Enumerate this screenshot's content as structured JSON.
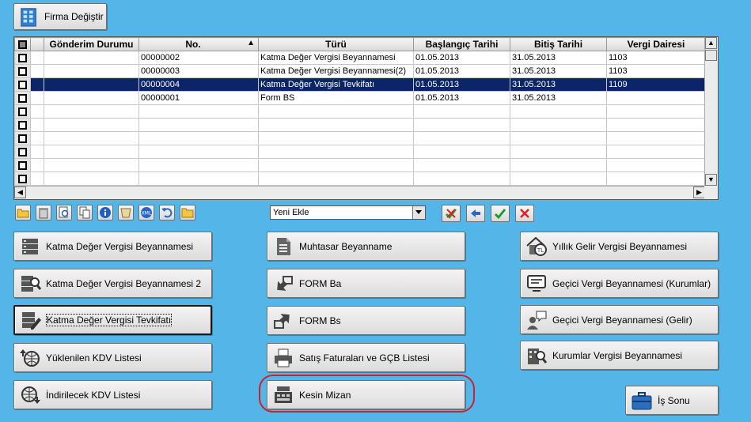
{
  "top_button": {
    "label": "Firma Değiştir",
    "icon": "building-icon"
  },
  "grid": {
    "columns": [
      "Gönderim Durumu",
      "No.",
      "Türü",
      "Başlangıç Tarihi",
      "Bitiş Tarihi",
      "Vergi Dairesi"
    ],
    "sort_indicator": "▲",
    "selected_row": 2,
    "rows": [
      {
        "status": "",
        "no": "00000002",
        "type": "Katma Değer Vergisi Beyannamesi",
        "start": "01.05.2013",
        "end": "31.05.2013",
        "office": "1103"
      },
      {
        "status": "",
        "no": "00000003",
        "type": "Katma Değer Vergisi Beyannamesi(2)",
        "start": "01.05.2013",
        "end": "31.05.2013",
        "office": "1103"
      },
      {
        "status": "",
        "no": "00000004",
        "type": "Katma Değer Vergisi Tevkifatı",
        "start": "01.05.2013",
        "end": "31.05.2013",
        "office": "1109"
      },
      {
        "status": "",
        "no": "00000001",
        "type": "Form BS",
        "start": "01.05.2013",
        "end": "31.05.2013",
        "office": ""
      },
      {
        "status": "",
        "no": "",
        "type": "",
        "start": "",
        "end": "",
        "office": ""
      },
      {
        "status": "",
        "no": "",
        "type": "",
        "start": "",
        "end": "",
        "office": ""
      },
      {
        "status": "",
        "no": "",
        "type": "",
        "start": "",
        "end": "",
        "office": ""
      },
      {
        "status": "",
        "no": "",
        "type": "",
        "start": "",
        "end": "",
        "office": ""
      },
      {
        "status": "",
        "no": "",
        "type": "",
        "start": "",
        "end": "",
        "office": ""
      },
      {
        "status": "",
        "no": "",
        "type": "",
        "start": "",
        "end": "",
        "office": ""
      }
    ]
  },
  "toolbar": {
    "icons": [
      "open-folder-icon",
      "trash-icon",
      "preview-icon",
      "copy-icon",
      "info-icon",
      "stamp-icon",
      "xml-icon",
      "undo-icon",
      "folder-icon"
    ],
    "combo_value": "Yeni Ekle",
    "action_icons": [
      "cancel-check-icon",
      "back-arrow-icon",
      "confirm-check-icon",
      "close-x-icon"
    ]
  },
  "buttons": {
    "kdv": "Katma Değer Vergisi Beyannamesi",
    "kdv2": "Katma Değer Vergisi Beyannamesi 2",
    "kdv_tevkifat": "Katma Değer Vergisi Tevkifatı",
    "yuklenilen_kdv": "Yüklenilen KDV Listesi",
    "indirilecek_kdv": "İndirilecek KDV Listesi",
    "muhtasar": "Muhtasar Beyanname",
    "form_ba": "FORM Ba",
    "form_bs": "FORM Bs",
    "satis_faturalari": "Satış Faturaları ve GÇB Listesi",
    "kesin_mizan": "Kesin Mizan",
    "yillik_gelir": "Yıllık Gelir Vergisi Beyannamesi",
    "gecici_kurumlar": "Geçici Vergi Beyannamesi (Kurumlar)",
    "gecici_gelir": "Geçici Vergi Beyannamesi (Gelir)",
    "kurumlar": "Kurumlar Vergisi Beyannamesi",
    "is_sonu": "İş Sonu"
  },
  "colors": {
    "background": "#54b6e8",
    "selected_row": "#0c2468",
    "highlight_ring": "#d0202a"
  }
}
